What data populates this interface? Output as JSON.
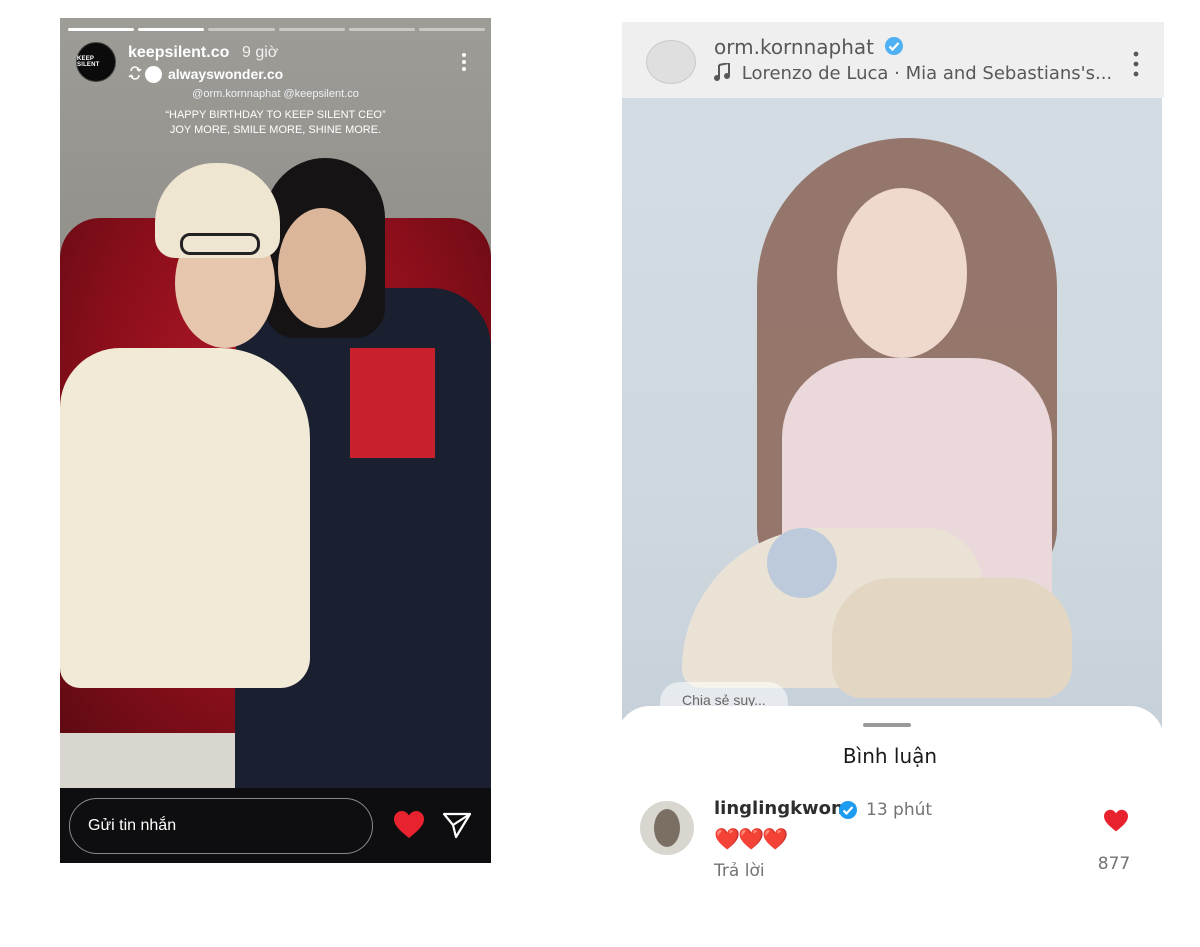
{
  "story": {
    "avatar_text": "KEEP SILENT",
    "username": "keepsilent.co",
    "time": "9 giờ",
    "repost_username": "alwayswonder.co",
    "mentions": "@orm.kornnaphat @keepsilent.co",
    "caption_line1": "“HAPPY BIRTHDAY TO KEEP SILENT CEO”",
    "caption_line2": "JOY MORE, SMILE MORE, SHINE MORE.",
    "message_placeholder": "Gửi tin nhắn",
    "icons": {
      "repost": "repost-icon",
      "more": "more-icon",
      "like": "heart-icon",
      "send": "send-icon"
    },
    "progress": {
      "segments": 6,
      "completed": 2
    }
  },
  "post": {
    "username": "orm.kornnaphat",
    "verified": true,
    "music": "Lorenzo de Luca · Mia and Sebastians's...",
    "share_chip": "Chia sẻ suy...",
    "comments_sheet": {
      "title": "Bình luận",
      "comment": {
        "username": "linglingkwong",
        "verified": true,
        "time": "13 phút",
        "text": "❤️❤️❤️",
        "reply_label": "Trả lời",
        "like_count": "877"
      }
    }
  },
  "colors": {
    "heart": "#e8232f",
    "verified": "#1d9bf0",
    "story_bg": "#0e0e10"
  }
}
